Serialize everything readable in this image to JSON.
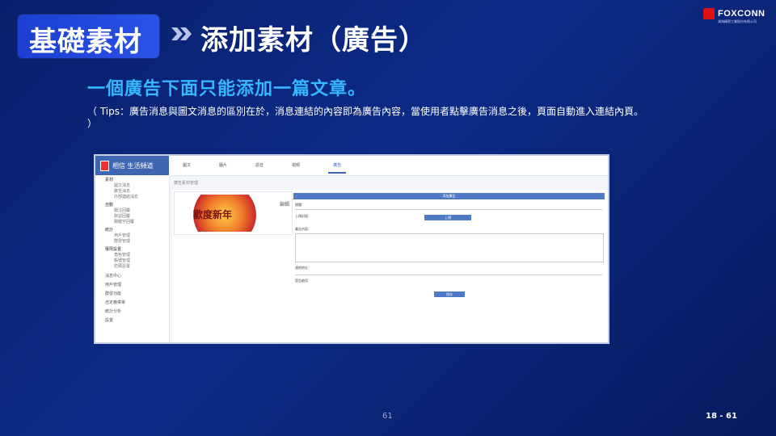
{
  "header": {
    "section_title": "基礎素材",
    "page_title": "添加素材（廣告）",
    "logo_name": "FOXCONN",
    "logo_sub": "鴻海精密工業股份有限公司"
  },
  "content": {
    "heading": "一個廣告下面只能添加一篇文章。",
    "tips": "（ Tips：廣告消息與圖文消息的區別在於，消息連結的內容即為廣告內容，當使用者點擊廣告消息之後，頁面自動進入連結內頁。 ）"
  },
  "screenshot": {
    "brand": "相信  生活頻道",
    "tabs": [
      "圖文",
      "圖片",
      "語音",
      "視頻",
      "廣告"
    ],
    "active_tab_index": 4,
    "sidebar_groups": [
      {
        "label": "素材",
        "subs": [
          "圖文消息",
          "廣告消息",
          "外部連結消息"
        ]
      },
      {
        "label": "自動",
        "subs": [
          "關注回覆",
          "默認回覆",
          "關鍵字回覆"
        ]
      },
      {
        "label": "統計",
        "subs": [
          "用戶管理",
          "群發管理"
        ]
      },
      {
        "label": "權限設置",
        "subs": [
          "角色管理",
          "帳號管理",
          "密碼設置"
        ]
      }
    ],
    "sidebar_items": [
      "消息中心",
      "用戶管理",
      "群發功能",
      "自定義菜單",
      "統計分析",
      "設置"
    ],
    "breadcrumb": "廣告素材管理",
    "card_image_text": "歡度新年",
    "card_edit": "編輯",
    "form_header": "添加廣告",
    "form_title_label": "標題：",
    "form_cover_label": "上傳封面：",
    "form_upload_button": "上傳",
    "form_content_label": "廣告內容：",
    "form_link_label": "連結地址：",
    "form_checkbox_label": "是否啟用",
    "form_save_button": "保存"
  },
  "footer": {
    "page_number": "61",
    "slide_number": "18 - 61"
  }
}
